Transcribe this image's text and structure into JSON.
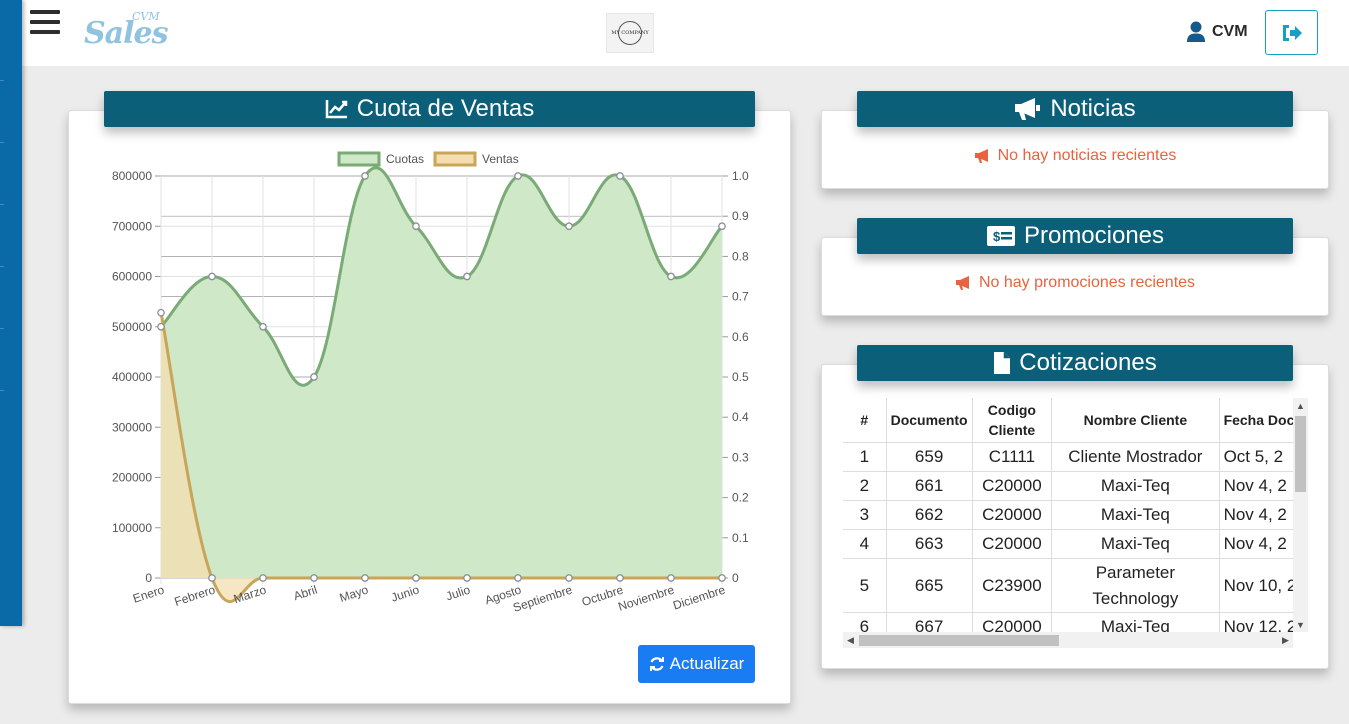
{
  "header": {
    "logo_text": "Sales",
    "logo_badge": "CVM",
    "company_logo_text": "MY COMPANY",
    "user_name": "CVM",
    "icons": {
      "menu": "hamburger-icon",
      "user": "user-icon",
      "logout": "sign-out-icon"
    }
  },
  "sales_card": {
    "title": "Cuota de Ventas",
    "icon": "line-chart-icon",
    "refresh_label": "Actualizar",
    "refresh_icon": "refresh-icon"
  },
  "chart_data": {
    "type": "line",
    "categories": [
      "Enero",
      "Febrero",
      "Marzo",
      "Abril",
      "Mayo",
      "Junio",
      "Julio",
      "Agosto",
      "Septiembre",
      "Octubre",
      "Noviembre",
      "Diciembre"
    ],
    "series": [
      {
        "name": "Cuotas",
        "axis": "left",
        "values": [
          500000,
          600000,
          500000,
          400000,
          800000,
          700000,
          600000,
          800000,
          700000,
          800000,
          600000,
          700000
        ],
        "color": "#7aab76",
        "fill": "#cfe8c7"
      },
      {
        "name": "Ventas",
        "axis": "right",
        "values": [
          0.66,
          0,
          0,
          0,
          0,
          0,
          0,
          0,
          0,
          0,
          0,
          0
        ],
        "color": "#c9a55a",
        "fill": "#f4ddb0"
      }
    ],
    "yticks_left": [
      "0",
      "100000",
      "200000",
      "300000",
      "400000",
      "500000",
      "600000",
      "700000",
      "800000"
    ],
    "yticks_right": [
      "0",
      "0.1",
      "0.2",
      "0.3",
      "0.4",
      "0.5",
      "0.6",
      "0.7",
      "0.8",
      "0.9",
      "1.0"
    ],
    "ylim_left": [
      0,
      800000
    ],
    "ylim_right": [
      0,
      1.0
    ],
    "legend_position": "top",
    "grid": true
  },
  "news_card": {
    "title": "Noticias",
    "icon": "bullhorn-icon",
    "empty_message": "No hay noticias recientes"
  },
  "promos_card": {
    "title": "Promociones",
    "icon": "money-bill-icon",
    "empty_message": "No hay promociones recientes"
  },
  "quotes_card": {
    "title": "Cotizaciones",
    "icon": "file-icon",
    "columns": [
      "#",
      "Documento",
      "Codigo Cliente",
      "Nombre Cliente",
      "Fecha Docu"
    ],
    "rows": [
      [
        "1",
        "659",
        "C1111",
        "Cliente Mostrador",
        "Oct 5, 2"
      ],
      [
        "2",
        "661",
        "C20000",
        "Maxi-Teq",
        "Nov 4, 2"
      ],
      [
        "3",
        "662",
        "C20000",
        "Maxi-Teq",
        "Nov 4, 2"
      ],
      [
        "4",
        "663",
        "C20000",
        "Maxi-Teq",
        "Nov 4, 2"
      ],
      [
        "5",
        "665",
        "C23900",
        "Parameter Technology",
        "Nov 10, 2"
      ],
      [
        "6",
        "667",
        "C20000",
        "Maxi-Teq",
        "Nov 12, 2"
      ]
    ]
  },
  "colors": {
    "header_bar": "#0c5f79",
    "alert_text": "#e8633f",
    "primary_button": "#1a7cf2",
    "sidebar": "#0a6aa8"
  }
}
